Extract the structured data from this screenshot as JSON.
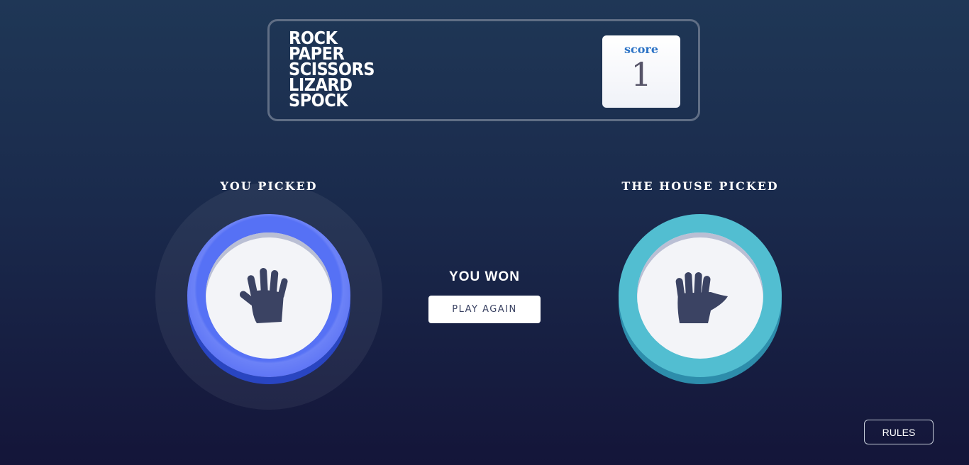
{
  "title": [
    "ROCK",
    "PAPER",
    "SCISSORS",
    "LIZARD",
    "SPOCK"
  ],
  "score": {
    "label": "score",
    "value": "1"
  },
  "player": {
    "label": "YOU PICKED",
    "choice_icon": "hand-paper-icon",
    "color": "#5671f5"
  },
  "house": {
    "label": "THE HOUSE PICKED",
    "choice_icon": "hand-spock-icon",
    "color": "#52bed1"
  },
  "result": {
    "text": "YOU WON",
    "button": "PLAY AGAIN"
  },
  "rules_button": "RULES"
}
